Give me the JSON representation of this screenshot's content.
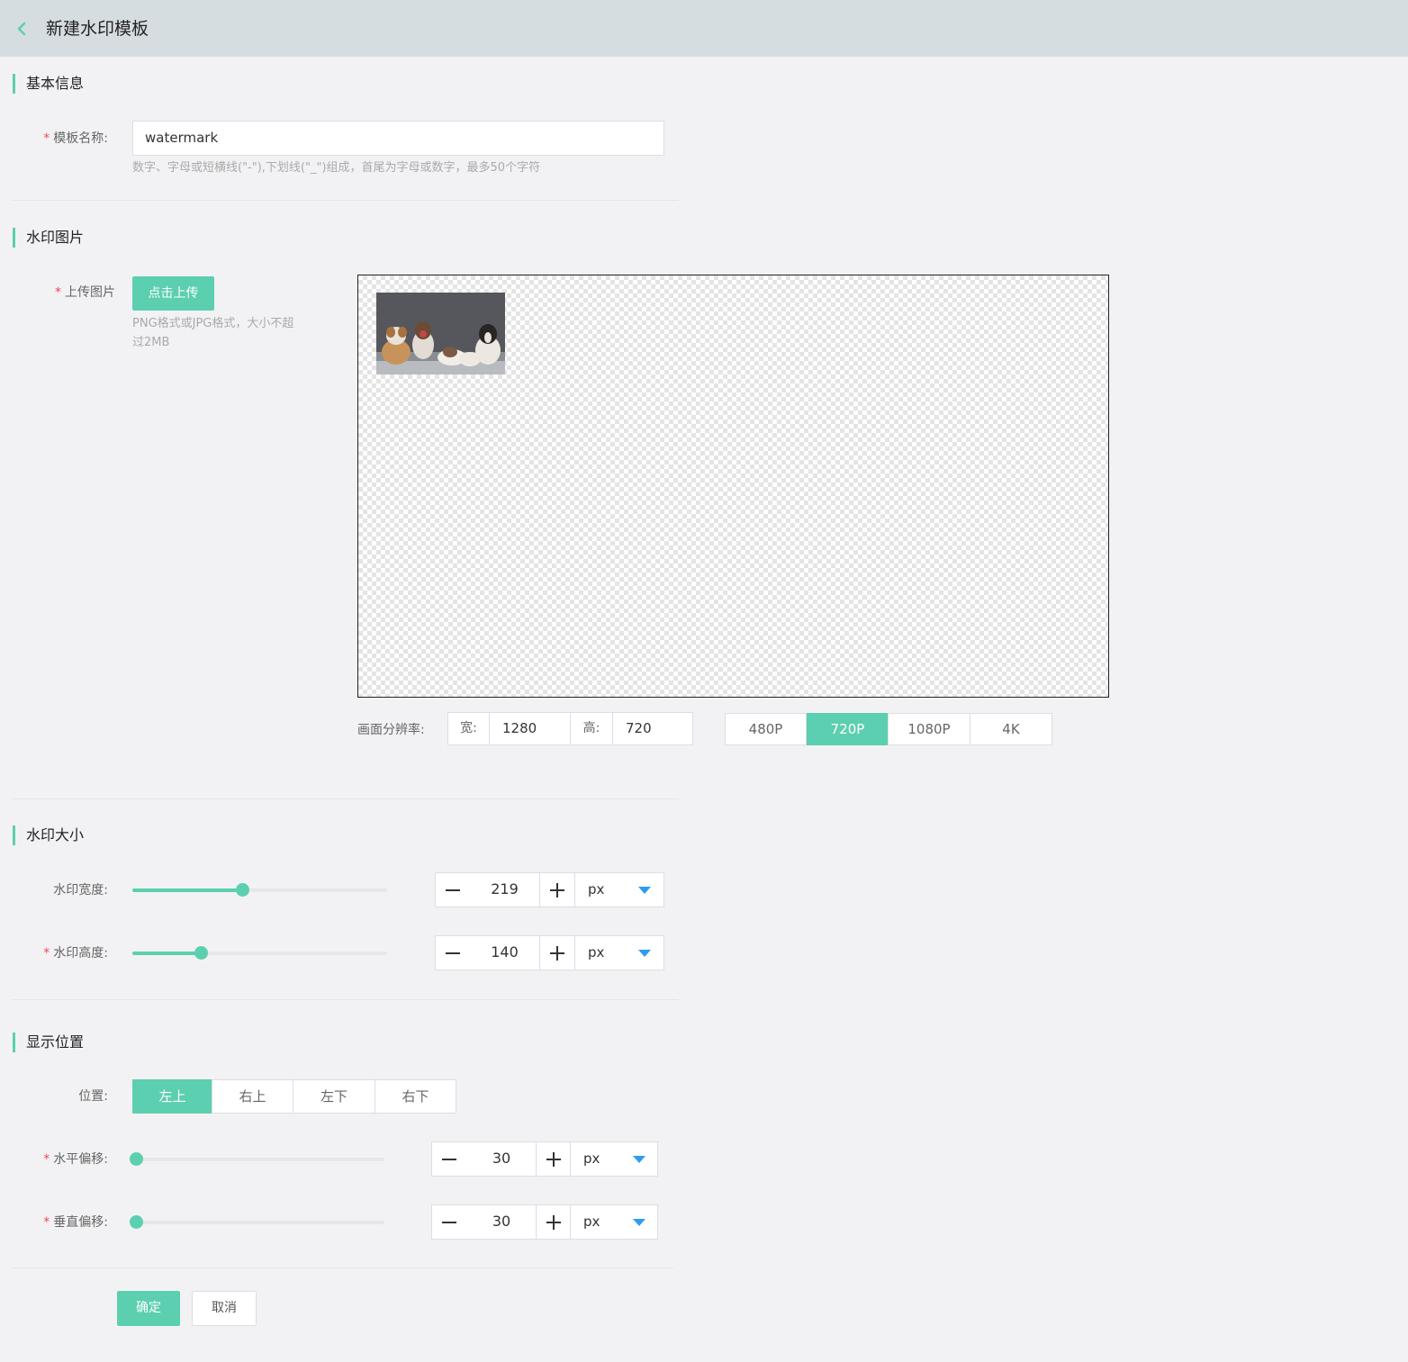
{
  "header": {
    "title": "新建水印模板"
  },
  "basic": {
    "section_title": "基本信息",
    "name_label": "模板名称:",
    "name_value": "watermark",
    "name_hint": "数字、字母或短横线(\"-\"),下划线(\"_\")组成，首尾为字母或数字，最多50个字符"
  },
  "image": {
    "section_title": "水印图片",
    "upload_label": "上传图片",
    "upload_button": "点击上传",
    "upload_hint_1": "PNG格式或JPG格式，大小不超",
    "upload_hint_2": "过2MB"
  },
  "resolution": {
    "label": "画面分辨率:",
    "width_label": "宽:",
    "width_value": "1280",
    "height_label": "高:",
    "height_value": "720",
    "presets": [
      "480P",
      "720P",
      "1080P",
      "4K"
    ],
    "active_preset": "720P"
  },
  "size": {
    "section_title": "水印大小",
    "width_label": "水印宽度:",
    "width_value": "219",
    "width_unit": "px",
    "width_slider_fraction": 0.43,
    "height_label": "水印高度:",
    "height_value": "140",
    "height_unit": "px",
    "height_slider_fraction": 0.27
  },
  "position": {
    "section_title": "显示位置",
    "pos_label": "位置:",
    "options": [
      "左上",
      "右上",
      "左下",
      "右下"
    ],
    "active_option": "左上",
    "h_offset_label": "水平偏移:",
    "h_offset_value": "30",
    "h_offset_unit": "px",
    "v_offset_label": "垂直偏移:",
    "v_offset_value": "30",
    "v_offset_unit": "px"
  },
  "footer": {
    "confirm": "确定",
    "cancel": "取消"
  },
  "colors": {
    "accent": "#5ccfb0",
    "required": "#f0475d",
    "caret": "#2d9cf0",
    "topbar": "#d6dde1"
  }
}
